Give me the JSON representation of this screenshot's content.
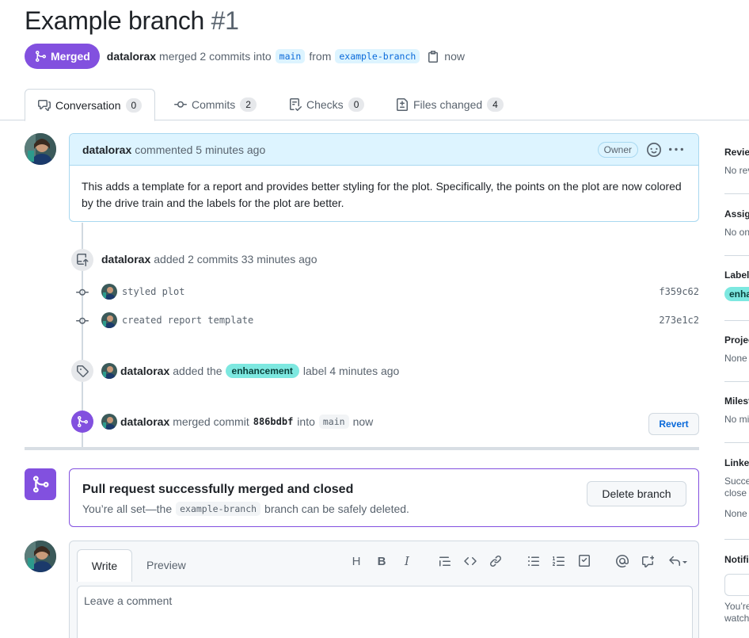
{
  "header": {
    "title": "Example branch",
    "number": "#1",
    "state": "Merged",
    "author": "datalorax",
    "merge_text": "merged 2 commits into",
    "base_branch": "main",
    "from_text": "from",
    "head_branch": "example-branch",
    "time": "now"
  },
  "tabs": [
    {
      "label": "Conversation",
      "count": "0"
    },
    {
      "label": "Commits",
      "count": "2"
    },
    {
      "label": "Checks",
      "count": "0"
    },
    {
      "label": "Files changed",
      "count": "4"
    }
  ],
  "comment": {
    "author": "datalorax",
    "meta": "commented 5 minutes ago",
    "badge": "Owner",
    "body": "This adds a template for a report and provides better styling for the plot. Specifically, the points on the plot are now colored by the drive train and the labels for the plot are better."
  },
  "timeline": {
    "commits_event": {
      "author": "datalorax",
      "text": "added 2 commits 33 minutes ago"
    },
    "commits": [
      {
        "message": "styled plot",
        "sha": "f359c62"
      },
      {
        "message": "created report template",
        "sha": "273e1c2"
      }
    ],
    "label_event": {
      "author": "datalorax",
      "text_before": "added the",
      "label": "enhancement",
      "text_after": "label 4 minutes ago"
    },
    "merge_event": {
      "author": "datalorax",
      "text_before": "merged commit",
      "sha": "886bdbf",
      "text_into": "into",
      "branch": "main",
      "time": "now",
      "revert_label": "Revert"
    }
  },
  "merged_box": {
    "title": "Pull request successfully merged and closed",
    "text_before": "You’re all set—the",
    "branch": "example-branch",
    "text_after": "branch can be safely deleted.",
    "delete_label": "Delete branch"
  },
  "editor": {
    "write_tab": "Write",
    "preview_tab": "Preview",
    "placeholder": "Leave a comment"
  },
  "sidebar": {
    "reviewers": {
      "heading": "Reviewers",
      "value": "No reviews"
    },
    "assignees": {
      "heading": "Assignees",
      "value": "No one"
    },
    "labels": {
      "heading": "Labels",
      "value": "enhancement"
    },
    "projects": {
      "heading": "Projects",
      "value": "None"
    },
    "milestone": {
      "heading": "Milestone",
      "value": "No milestone"
    },
    "linked": {
      "heading": "Linked issues",
      "value_1": "Successfully merging",
      "value_2": "close these issues.",
      "value_3": "None"
    },
    "notifications": {
      "heading": "Notifications",
      "value_1": "You’re receiving",
      "value_2": "watching"
    }
  },
  "colors": {
    "merged": "#8250df",
    "link": "#0969da",
    "label": "#7de8e0"
  },
  "icons": [
    "git-merge-icon",
    "copy-icon",
    "comment-icon",
    "commit-icon",
    "checklist-icon",
    "file-diff-icon",
    "smiley-icon",
    "kebab-icon",
    "repo-push-icon",
    "tag-icon"
  ]
}
